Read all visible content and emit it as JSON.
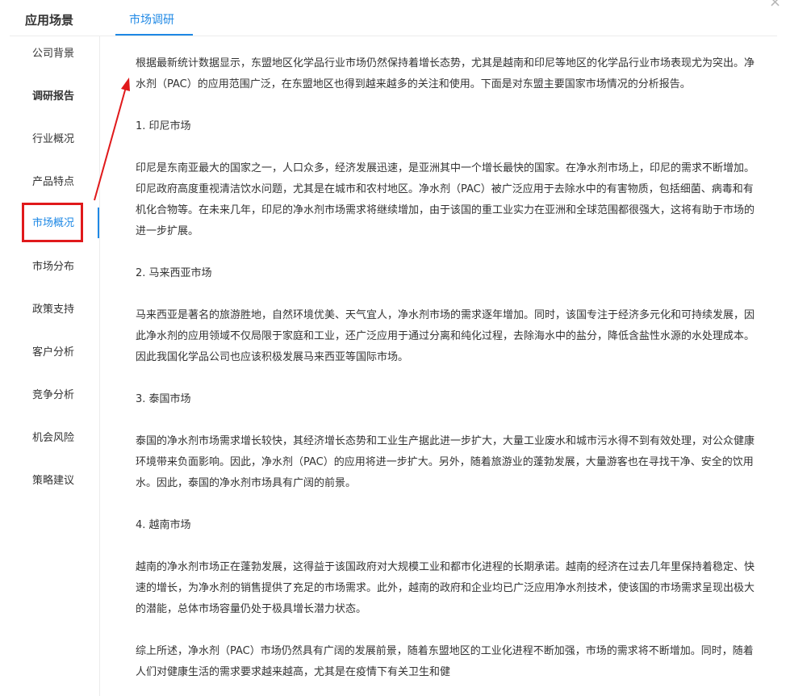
{
  "window": {
    "close_label": "×"
  },
  "sidebar": {
    "title": "应用场景",
    "items": [
      {
        "label": "公司背景"
      },
      {
        "label": "调研报告"
      },
      {
        "label": "行业概况"
      },
      {
        "label": "产品特点"
      },
      {
        "label": "市场概况"
      },
      {
        "label": "市场分布"
      },
      {
        "label": "政策支持"
      },
      {
        "label": "客户分析"
      },
      {
        "label": "竞争分析"
      },
      {
        "label": "机会风险"
      },
      {
        "label": "策略建议"
      }
    ],
    "active_item": "市场概况"
  },
  "tabs": [
    {
      "label": "市场调研"
    }
  ],
  "content": {
    "intro": "根据最新统计数据显示，东盟地区化学品行业市场仍然保持着增长态势，尤其是越南和印尼等地区的化学品行业市场表现尤为突出。净水剂（PAC）的应用范围广泛，在东盟地区也得到越来越多的关注和使用。下面是对东盟主要国家市场情况的分析报告。",
    "s1_title": "1. 印尼市场",
    "s1_body": "印尼是东南亚最大的国家之一，人口众多，经济发展迅速，是亚洲其中一个增长最快的国家。在净水剂市场上，印尼的需求不断增加。印尼政府高度重视清洁饮水问题，尤其是在城市和农村地区。净水剂（PAC）被广泛应用于去除水中的有害物质，包括细菌、病毒和有机化合物等。在未来几年，印尼的净水剂市场需求将继续增加，由于该国的重工业实力在亚洲和全球范围都很强大，这将有助于市场的进一步扩展。",
    "s2_title": "2. 马来西亚市场",
    "s2_body": "马来西亚是著名的旅游胜地，自然环境优美、天气宜人，净水剂市场的需求逐年增加。同时，该国专注于经济多元化和可持续发展，因此净水剂的应用领域不仅局限于家庭和工业，还广泛应用于通过分离和纯化过程，去除海水中的盐分，降低含盐性水源的水处理成本。因此我国化学品公司也应该积极发展马来西亚等国际市场。",
    "s3_title": "3. 泰国市场",
    "s3_body": "泰国的净水剂市场需求增长较快，其经济增长态势和工业生产据此进一步扩大，大量工业废水和城市污水得不到有效处理，对公众健康环境带来负面影响。因此，净水剂（PAC）的应用将进一步扩大。另外，随着旅游业的蓬勃发展，大量游客也在寻找干净、安全的饮用水。因此，泰国的净水剂市场具有广阔的前景。",
    "s4_title": "4. 越南市场",
    "s4_body": "越南的净水剂市场正在蓬勃发展，这得益于该国政府对大规模工业和都市化进程的长期承诺。越南的经济在过去几年里保持着稳定、快速的增长，为净水剂的销售提供了充足的市场需求。此外，越南的政府和企业均已广泛应用净水剂技术，使该国的市场需求呈现出极大的潜能，总体市场容量仍处于极具增长潜力状态。",
    "conclusion": "综上所述，净水剂（PAC）市场仍然具有广阔的发展前景，随着东盟地区的工业化进程不断加强，市场的需求将不断增加。同时，随着人们对健康生活的需求要求越来越高，尤其是在疫情下有关卫生和健"
  },
  "colors": {
    "accent": "#1e88e5",
    "annotation": "#e0191b"
  }
}
